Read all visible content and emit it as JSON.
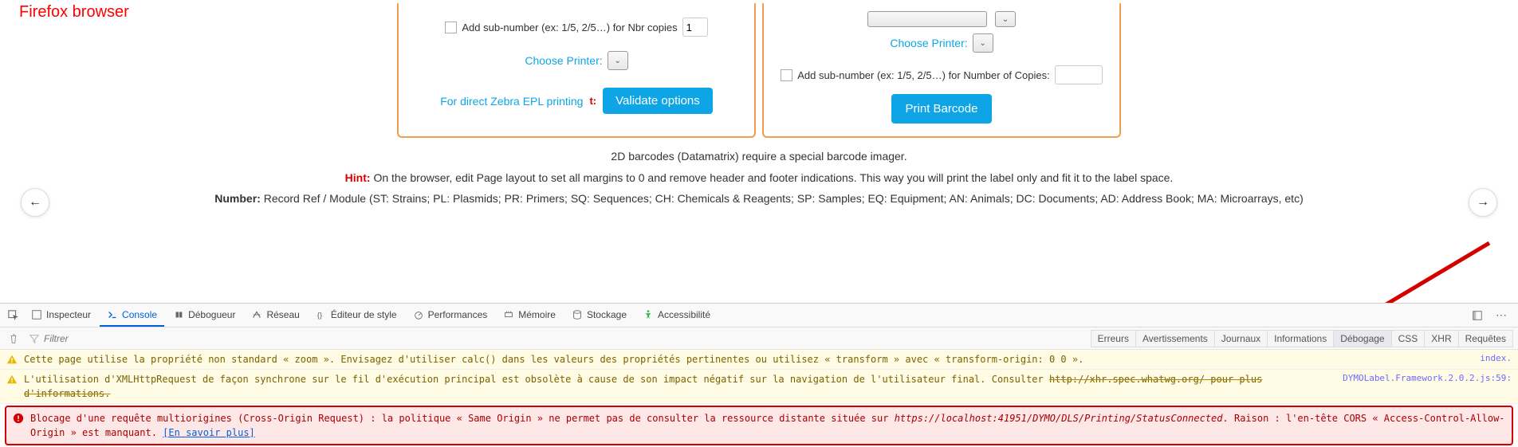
{
  "annotation": "Firefox browser",
  "panel_left": {
    "sub_number_label": "Add sub-number (ex: 1/5, 2/5…) for Nbr copies",
    "copies_value": "1",
    "choose_printer": "Choose Printer:",
    "zebra_label": "For direct Zebra EPL printing",
    "zebra_mark": "t:",
    "validate_btn": "Validate options"
  },
  "panel_right": {
    "choose_printer": "Choose Printer:",
    "sub_number_label": "Add sub-number (ex: 1/5, 2/5…) for Number of Copies:",
    "copies_value": "",
    "print_btn": "Print Barcode"
  },
  "info": {
    "datamatrix": "2D barcodes (Datamatrix) require a special barcode imager.",
    "hint_label": "Hint:",
    "hint_text": " On the browser, edit Page layout to set all margins to 0 and remove header and footer indications. This way you will print the label only and fit it to the label space.",
    "number_label": "Number:",
    "number_text": " Record Ref / Module (ST: Strains; PL: Plasmids; PR: Primers; SQ: Sequences; CH: Chemicals & Reagents; SP: Samples; EQ: Equipment; AN: Animals; DC: Documents; AD: Address Book; MA: Microarrays, etc)"
  },
  "devtools": {
    "tabs": {
      "inspector": "Inspecteur",
      "console": "Console",
      "debugger": "Débogueur",
      "network": "Réseau",
      "style": "Éditeur de style",
      "performance": "Performances",
      "memory": "Mémoire",
      "storage": "Stockage",
      "accessibility": "Accessibilité"
    },
    "filter_placeholder": "Filtrer",
    "categories": {
      "errors": "Erreurs",
      "warnings": "Avertissements",
      "logs": "Journaux",
      "info": "Informations",
      "debug": "Débogage",
      "css": "CSS",
      "xhr": "XHR",
      "requests": "Requêtes"
    },
    "messages": {
      "warn1_text": "Cette page utilise la propriété non standard « zoom ». Envisagez d'utiliser calc() dans les valeurs des propriétés pertinentes ou utilisez « transform » avec « transform-origin: 0 0 ».",
      "warn1_src": "index.",
      "warn2_a": "L'utilisation d'XMLHttpRequest de façon synchrone sur le fil d'exécution principal est obsolète à cause de son impact négatif sur la navigation de l'utilisateur final. Consulter ",
      "warn2_struck": "http://xhr.spec.whatwg.org/ pour plus d'informations.",
      "warn2_src": "DYMOLabel.Framework.2.0.2.js:59:",
      "err_a": "Blocage d'une requête multiorigines (Cross-Origin Request) : la politique « Same Origin » ne permet pas de consulter la ressource distante située sur ",
      "err_url": "https://localhost:41951/DYMO/DLS/Printing/StatusConnected",
      "err_b": ". Raison : l'en-tête CORS « Access-Control-Allow-Origin » est manquant. ",
      "err_learn": "[En savoir plus]"
    }
  }
}
